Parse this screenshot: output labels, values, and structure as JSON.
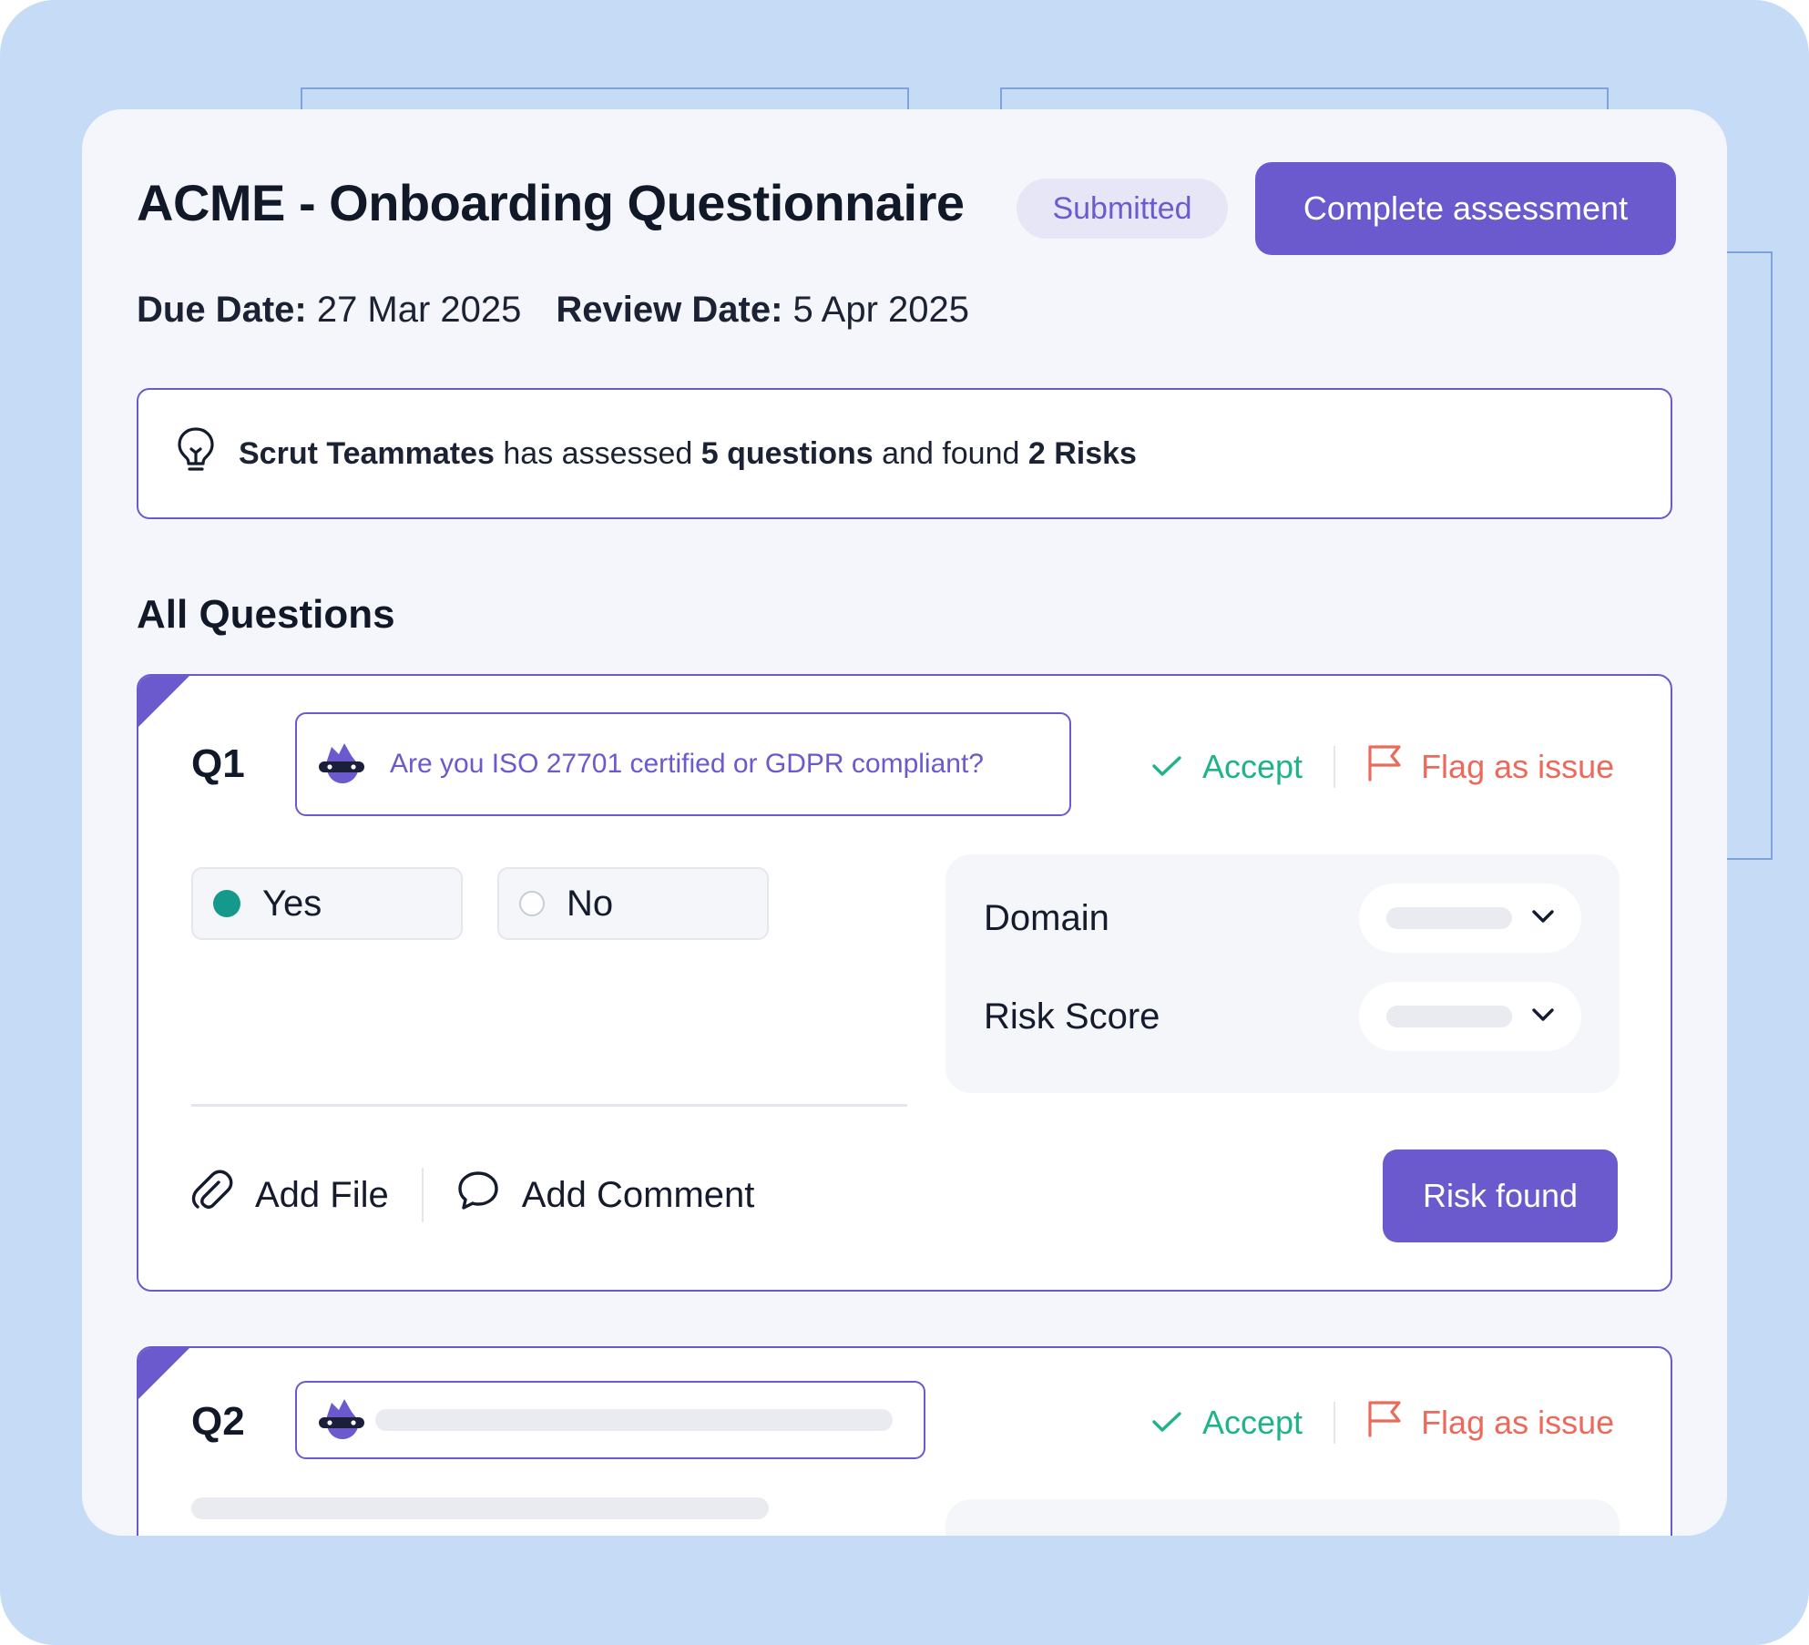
{
  "header": {
    "title": "ACME - Onboarding Questionnaire",
    "status_badge": "Submitted",
    "primary_action": "Complete assessment",
    "due_date_label": "Due Date:",
    "due_date_value": "27 Mar 2025",
    "review_date_label": "Review Date:",
    "review_date_value": "5 Apr 2025"
  },
  "insight": {
    "actor": "Scrut Teammates",
    "text_1": "has assessed",
    "questions": "5 questions",
    "text_2": "and found",
    "risks": "2 Risks"
  },
  "section": {
    "title": "All Questions"
  },
  "questions": [
    {
      "number": "Q1",
      "text": "Are you ISO 27701 certified or GDPR compliant?",
      "accept_label": "Accept",
      "flag_label": "Flag as issue",
      "options": [
        "Yes",
        "No"
      ],
      "selected": "Yes",
      "fields": [
        {
          "label": "Domain"
        },
        {
          "label": "Risk Score"
        }
      ],
      "add_file_label": "Add File",
      "add_comment_label": "Add Comment",
      "risk_button_label": "Risk found"
    },
    {
      "number": "Q2",
      "accept_label": "Accept",
      "flag_label": "Flag as issue"
    }
  ],
  "colors": {
    "accent": "#6a5acd",
    "accept": "#1fb38a",
    "flag": "#ec6a5c",
    "selected_radio": "#15998c",
    "backdrop": "#c6dcf6"
  },
  "icons": {
    "insight": "lightbulb-icon",
    "question": "ai-assistant-icon",
    "accept": "check-icon",
    "flag": "flag-icon",
    "dropdown": "chevron-down-icon",
    "file": "paperclip-icon",
    "comment": "speech-bubble-icon"
  }
}
